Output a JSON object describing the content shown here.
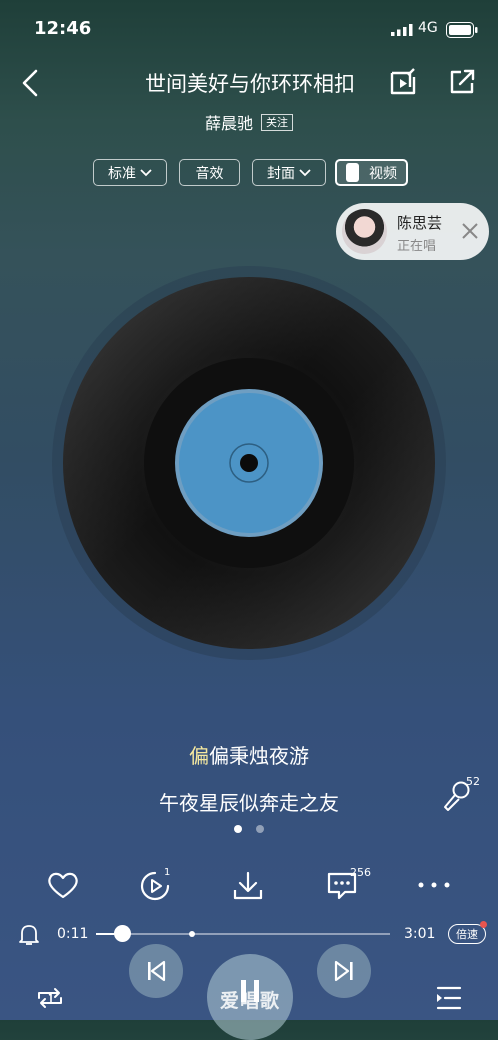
{
  "status_bar": {
    "time": "12:46",
    "network": "4G"
  },
  "header": {
    "title": "世间美好与你环环相扣",
    "artist": "薛晨驰",
    "follow_label": "关注"
  },
  "options": {
    "quality": "标准",
    "effect": "音效",
    "cover": "封面",
    "video": "视频"
  },
  "singer": {
    "name": "陈思芸",
    "status": "正在唱"
  },
  "lyrics": {
    "highlight": "偏",
    "line1_rest": "偏秉烛夜游",
    "line2": "午夜星辰似奔走之友"
  },
  "counts": {
    "mic": "52",
    "video": "1",
    "comments": "256"
  },
  "progress": {
    "elapsed": "0:11",
    "duration": "3:01",
    "fraction": 0.09,
    "speed_label": "倍速"
  },
  "watermark": "爱唱歌",
  "icons": [
    "back-icon",
    "share-video-icon",
    "share-icon",
    "chevron-down-icon",
    "close-icon",
    "microphone-icon",
    "heart-icon",
    "video-play-icon",
    "download-icon",
    "comment-icon",
    "more-icon",
    "bell-icon",
    "repeat-icon",
    "previous-icon",
    "pause-icon",
    "next-icon",
    "playlist-icon"
  ]
}
